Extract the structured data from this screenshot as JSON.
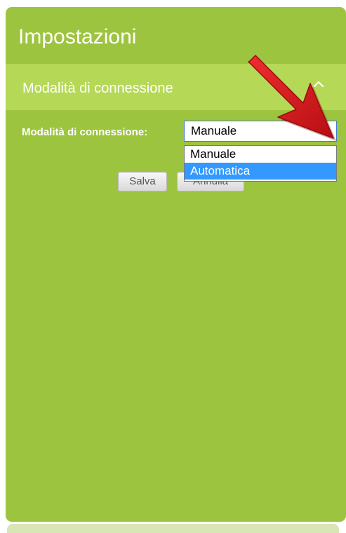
{
  "panel": {
    "title": "Impostazioni",
    "section_title": "Modalità di connessione"
  },
  "form": {
    "connection_mode_label": "Modalità di connessione:",
    "select_value": "Manuale",
    "select_arrow": "▼",
    "options": [
      {
        "label": "Manuale",
        "highlighted": false
      },
      {
        "label": "Automatica",
        "highlighted": true
      }
    ]
  },
  "buttons": {
    "save_label": "Salva",
    "cancel_label": "Annulla"
  },
  "colors": {
    "panel_background": "#9dc43f",
    "section_header_background": "#b6d857",
    "highlight": "#3399ff",
    "annotation_arrow": "#d7141b"
  },
  "icons": {
    "chevron": "chevron-up-icon",
    "annotation": "red-arrow-icon",
    "dropdown": "dropdown-arrow-icon"
  }
}
